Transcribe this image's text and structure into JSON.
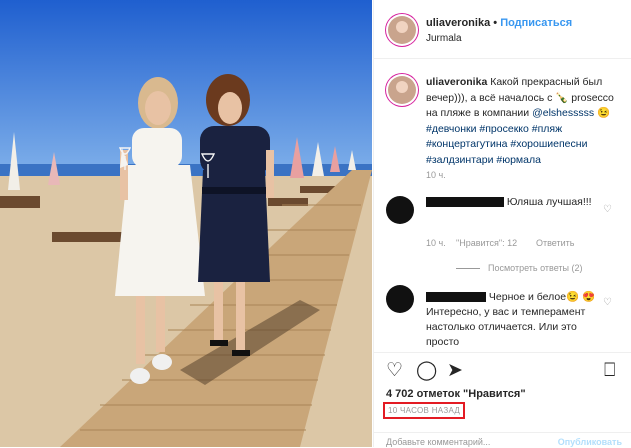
{
  "post": {
    "username": "uliaveronika",
    "separator": "•",
    "follow_label": "Подписаться",
    "location": "Jurmala"
  },
  "caption": {
    "username": "uliaveronika",
    "text_1": "Какой прекрасный был вечер))), а всё началось с",
    "emoji": "🍾",
    "text_2": "prosecco на пляже в компании",
    "mention": "@elshesssss",
    "emoji_2": "😉",
    "hashtags": "#девчонки #просекко #пляж #концертагутина #хорошиепесни #залдзинтари #юрмала",
    "time": "10 ч."
  },
  "comments": [
    {
      "text": "Юляша лучшая!!!",
      "time": "10 ч.",
      "likes": "\"Нравится\": 12",
      "reply_label": "Ответить",
      "view_replies": "Посмотреть ответы (2)"
    },
    {
      "text": "Черное и белое😉 😍 Интересно, у вас и темперамент настолько отличается. Или это просто"
    }
  ],
  "actions": {
    "like_icon": "heart-outline-icon",
    "comment_icon": "speech-bubble-icon",
    "share_icon": "paper-plane-icon",
    "save_icon": "bookmark-icon"
  },
  "likes_count": "4 702 отметок \"Нравится\"",
  "timestamp": "10 ЧАСОВ НАЗАД",
  "add_comment": {
    "placeholder": "Добавьте комментарий...",
    "publish_label": "Опубликовать"
  },
  "colors": {
    "link": "#3897f0",
    "hashtag": "#003569",
    "highlight": "#e31b23",
    "sky": "#2f6fd2",
    "sand": "#dcc7a6"
  }
}
